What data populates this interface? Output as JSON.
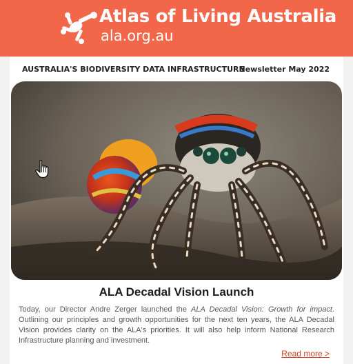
{
  "header": {
    "brand_name": "Atlas of Living Australia",
    "brand_url": "ala.org.au",
    "logo_icon": "ala-logo-icon",
    "background_color": "#f26649"
  },
  "newsletter": {
    "tagline": "AUSTRALIA'S BIODIVERSITY DATA INFRASTRUCTURE",
    "issue": "Newsletter May 2022"
  },
  "article": {
    "title": "ALA Decadal Vision Launch",
    "body_part1": "Today, our Director Andre Zerger launched the ",
    "body_emphasis": "ALA Decadal Vision: Growth for impact",
    "body_part2": ". Outlining our principles and growth opportunities for the next ten years, the ALA Decadal Vision provides clarity on the ALA's priorities. It will also help inform National Research Infrastructure planning and investment.",
    "read_more_label": "Read more >",
    "link_color": "#d5401c"
  },
  "cursor": {
    "icon": "hand-pointer-icon"
  }
}
